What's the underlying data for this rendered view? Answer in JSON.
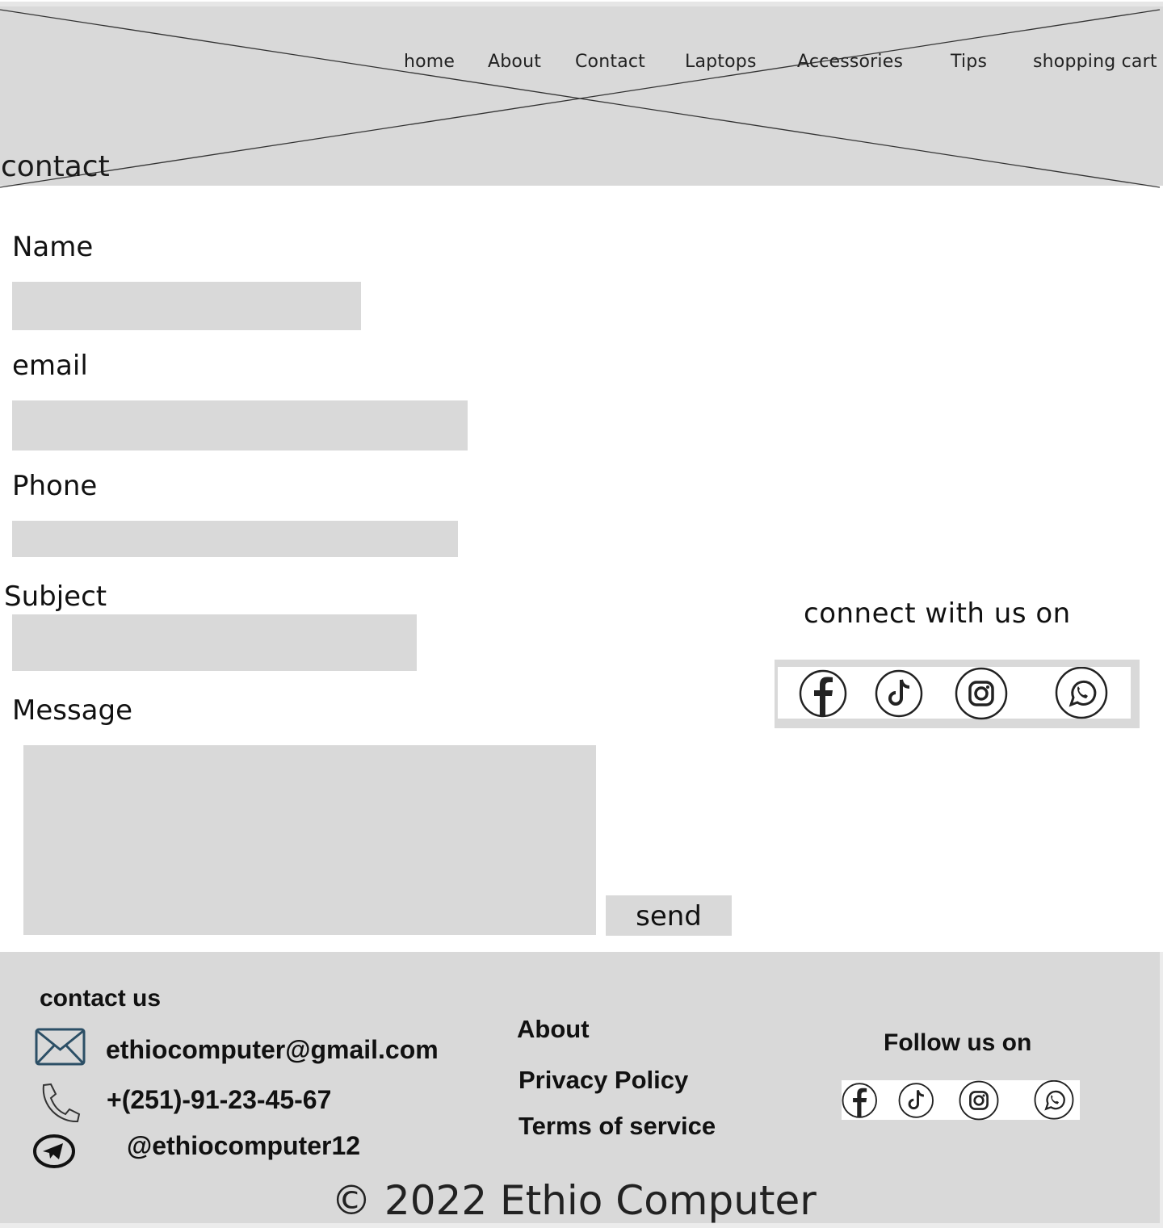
{
  "nav": {
    "items": [
      "home",
      "About",
      "Contact",
      "Laptops",
      "Accessories",
      "Tips",
      "shopping cart"
    ]
  },
  "hero": {
    "title": "contact"
  },
  "form": {
    "name_label": "Name",
    "email_label": "email",
    "phone_label": "Phone",
    "subject_label": "Subject",
    "message_label": "Message",
    "send_label": "send"
  },
  "connect": {
    "title": "connect with us on",
    "icons": [
      "facebook-icon",
      "tiktok-icon",
      "instagram-icon",
      "whatsapp-icon"
    ]
  },
  "footer": {
    "contact_title": "contact us",
    "email": "ethiocomputer@gmail.com",
    "phone": "+(251)-91-23-45-67",
    "telegram": "@ethiocomputer12",
    "links": [
      "About",
      "Privacy Policy",
      "Terms of service"
    ],
    "follow_title": "Follow us on",
    "copyright": "© 2022 Ethio Computer"
  },
  "colors": {
    "placeholder_gray": "#d9d9d9",
    "mail_icon_blue": "#2c4f66"
  }
}
